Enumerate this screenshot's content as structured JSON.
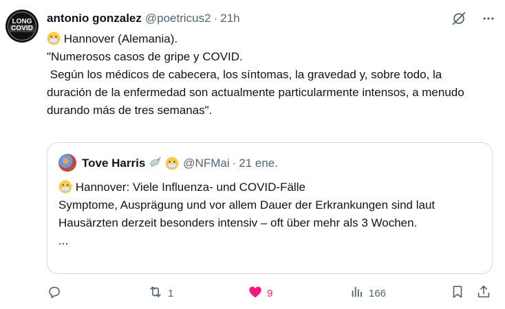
{
  "tweet": {
    "author": {
      "display_name": "antonio gonzalez",
      "handle": "@poetricus2",
      "time": "21h",
      "avatar_text_top": "LONG",
      "avatar_text_bottom": "COVID"
    },
    "body_lines": [
      "Hannover (Alemania).",
      "",
      "\"Numerosos casos de gripe y COVID.",
      " Según los médicos de cabecera, los síntomas, la gravedad y, sobre todo, la duración de la enfermedad son actualmente particularmente intensos, a menudo durando más de tres semanas\"."
    ],
    "icons": {
      "grok": "grok-icon",
      "more": "more-icon",
      "mask_emoji": "face-with-medical-mask-icon"
    },
    "quoted": {
      "display_name": "Tove Harris",
      "handle": "@NFMai",
      "date": "21 ene.",
      "line1": "Hannover: Viele Influenza- und COVID-Fälle",
      "line2": "",
      "line3": "Symptome, Ausprägung und vor allem Dauer der Erkrankungen sind laut Hausärzten derzeit besonders intensiv – oft über mehr als 3 Wochen.",
      "line4": "..."
    },
    "actions": {
      "replies": "",
      "reposts": "1",
      "likes": "9",
      "views": "166"
    },
    "colors": {
      "text": "#0f1419",
      "muted": "#536471",
      "like": "#f91880",
      "border": "#cfd9de"
    }
  }
}
